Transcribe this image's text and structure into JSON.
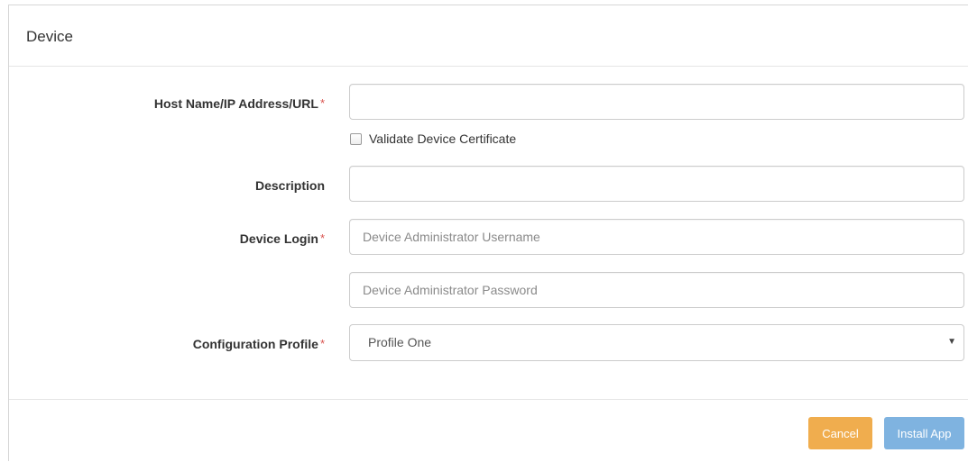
{
  "dialog": {
    "title": "Device"
  },
  "form": {
    "host": {
      "label": "Host Name/IP Address/URL",
      "required_mark": "*",
      "value": "",
      "placeholder": ""
    },
    "validate_certificate": {
      "label": "Validate Device Certificate",
      "checked": false
    },
    "description": {
      "label": "Description",
      "value": "",
      "placeholder": ""
    },
    "device_login": {
      "label": "Device Login",
      "required_mark": "*",
      "username_placeholder": "Device Administrator Username",
      "password_placeholder": "Device Administrator Password"
    },
    "configuration_profile": {
      "label": "Configuration Profile",
      "required_mark": "*",
      "selected": "Profile One",
      "caret": "▼"
    }
  },
  "footer": {
    "cancel_label": "Cancel",
    "install_label": "Install App"
  },
  "colors": {
    "required": "#d9534f",
    "cancel_button": "#f0ad4e",
    "install_button": "#7fb3e0"
  }
}
